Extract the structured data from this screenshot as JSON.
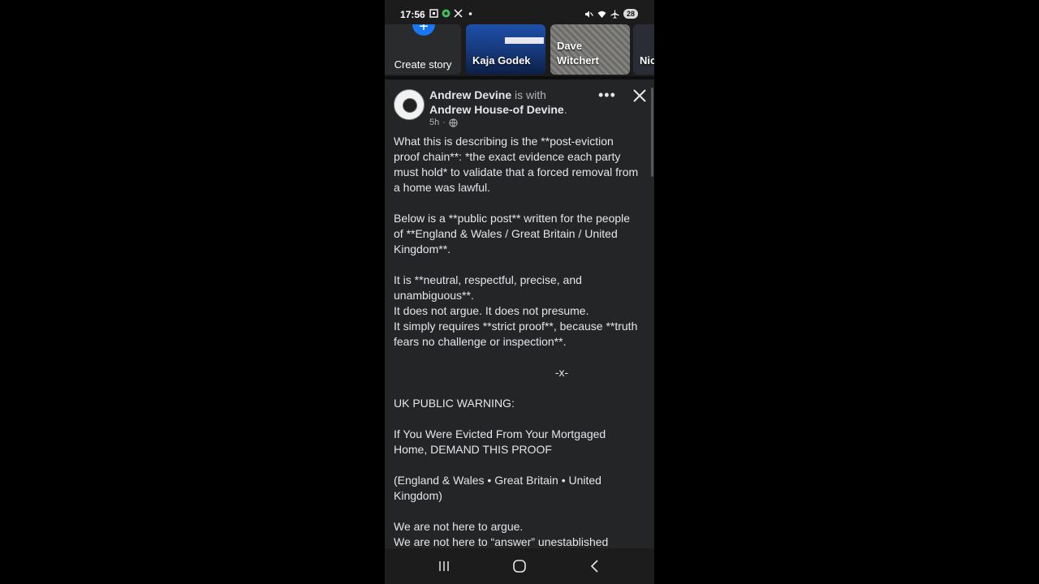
{
  "status_bar": {
    "time": "17:56",
    "battery_level": "28",
    "left_icons": [
      "screenshot-icon",
      "app-icon",
      "x-logo-icon",
      "dot-icon"
    ],
    "right_icons": [
      "mute-icon",
      "wifi-icon",
      "airplane-icon",
      "battery-icon"
    ]
  },
  "stories": {
    "create_label": "Create story",
    "items": [
      {
        "name": "Kaja Godek"
      },
      {
        "name": "Dave\nWitchert"
      },
      {
        "name": "Nic"
      }
    ]
  },
  "post": {
    "author": "Andrew Devine",
    "is_with": "is with",
    "tagged": "Andrew House-of Devine",
    "tagged_suffix": ".",
    "age": "5h",
    "separator": "·",
    "audience_icon": "globe-icon",
    "paragraphs": [
      "What this is describing is the **post-eviction proof chain**: *the exact evidence each party must hold* to validate that a forced removal from a home was lawful.",
      "Below is a **public post** written for the people of **England & Wales / Great Britain / United Kingdom**.",
      "It is **neutral, respectful, precise, and unambiguous**.\nIt does not argue. It does not presume.\nIt simply requires **strict proof**, because **truth fears no challenge or inspection**.",
      "",
      " UK PUBLIC WARNING:",
      "If You Were Evicted From Your Mortgaged Home, DEMAND THIS PROOF",
      " (England & Wales • Great Britain • United Kingdom)",
      "We are not here to argue.\nWe are not here to “answer” unestablished"
    ],
    "separator_mark": "-x-"
  },
  "navbar": {
    "buttons": [
      "recent-apps-icon",
      "home-icon",
      "back-icon"
    ]
  },
  "colors": {
    "background": "#000000",
    "card": "#242526",
    "text": "#e4e6eb",
    "muted": "#b0b3b8",
    "accent": "#1877f2"
  }
}
